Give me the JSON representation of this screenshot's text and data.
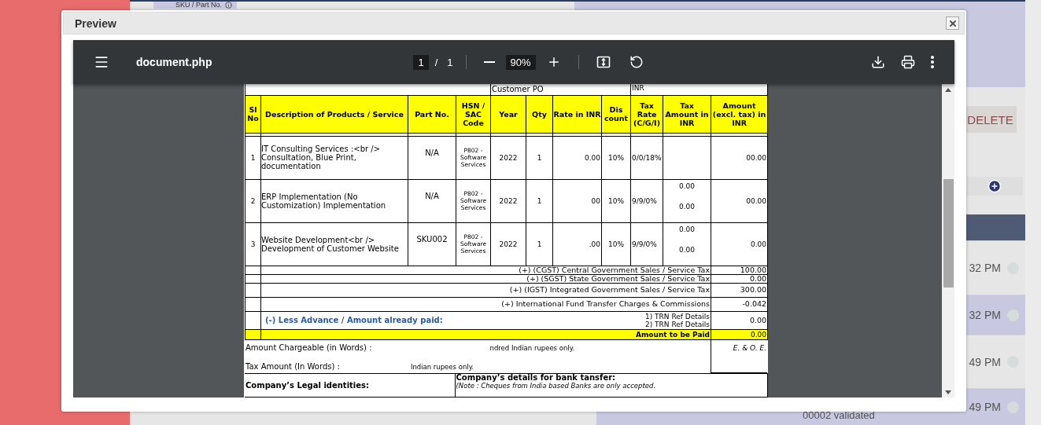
{
  "background": {
    "tab": "SKU / Part No.",
    "delete_button": "DELETE",
    "rows": [
      {
        "time": "32 PM"
      },
      {
        "time": "32 PM"
      },
      {
        "time": "49 PM"
      },
      {
        "time": "49 PM",
        "note": "00002 validated"
      }
    ]
  },
  "modal": {
    "title": "Preview"
  },
  "viewer": {
    "filename": "document.php",
    "page": "1",
    "separator": "/",
    "pages": "1",
    "zoom": "90%"
  },
  "document": {
    "top_row": [
      "Customer PO",
      "INR"
    ],
    "columns": [
      "Sl No",
      "Description of Products / Service",
      "Part No.",
      "HSN / SAC Code",
      "Year",
      "Qty",
      "Rate in INR",
      "Dis count",
      "Tax Rate (C/G/I)",
      "Tax Amount in INR",
      "Amount (excl. tax) in INR"
    ],
    "items": [
      {
        "sl": "1",
        "description": "IT Consulting Services :<br /> Consultation, Blue Print, documentation",
        "part": "N/A",
        "hsn": "P802 - Software Services",
        "year": "2022",
        "qty": "1",
        "rate": "0.00",
        "discount": "10%",
        "tax_rate": "0/0/18%",
        "amount": "00.00"
      },
      {
        "sl": "2",
        "description": "ERP Implementation (No Customization) Implementation",
        "part": "N/A",
        "hsn": "P802 - Software Services",
        "year": "2022",
        "qty": "1",
        "rate": "00",
        "discount": "10%",
        "tax_rate": "9/9/0%",
        "tax_amount": [
          "0.00",
          "0.00"
        ],
        "amount": "00.00"
      },
      {
        "sl": "3",
        "description": "Website Development<br /> Development of Customer Website",
        "part": "SKU002",
        "hsn": "P802 - Software Services",
        "year": "2022",
        "qty": "1",
        "rate": ".00",
        "discount": "10%",
        "tax_rate": "9/9/0%",
        "tax_amount": [
          "0.00",
          "0.00"
        ],
        "amount": "0.00"
      }
    ],
    "summary": [
      {
        "label": "(+) (CGST) Central Government Sales / Service Tax",
        "value": "100.00"
      },
      {
        "label": "(+) (SGST) State Government Sales / Service Tax",
        "value": "0.00"
      },
      {
        "label": "(+) (IGST) Integrated Government Sales / Service Tax",
        "value": "300.00"
      },
      {
        "label": "(+) International Fund Transfer Charges & Commissions",
        "value": "-0.042"
      }
    ],
    "advance": {
      "label": "(-) Less Advance / Amount already paid:",
      "refs": [
        "1) TRN Ref Details",
        "2) TRN Ref Details"
      ],
      "value": "0.00"
    },
    "total": {
      "label": "Amount to be Paid",
      "value": "0.00"
    },
    "words": {
      "chargeable_label": "Amount Chargeable (in Words) :",
      "chargeable_value": "ndred Indian rupees only.",
      "tax_label": "Tax Amount (In Words) :",
      "tax_value": "Indian rupees only.",
      "eoe": "E. & O. E."
    },
    "legal": "Company’s Legal identities:",
    "bank_title": "Company’s details for bank tansfer:",
    "bank_note": "(Note : Cheques from India based Banks are only accepted."
  }
}
